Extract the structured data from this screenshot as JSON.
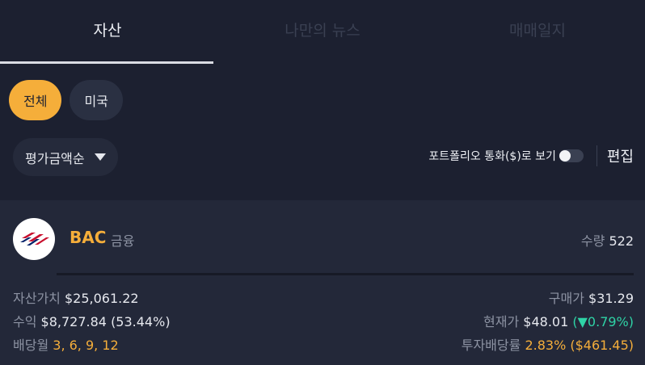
{
  "tabs": [
    {
      "label": "자산",
      "active": true
    },
    {
      "label": "나만의 뉴스",
      "active": false
    },
    {
      "label": "매매일지",
      "active": false
    }
  ],
  "filters": {
    "all": "전체",
    "us": "미국"
  },
  "sort": {
    "label": "평가금액순"
  },
  "portfolio_currency_toggle": {
    "label": "포트폴리오 통화($)로 보기",
    "on": false
  },
  "edit_label": "편집",
  "holding": {
    "ticker": "BAC",
    "sector": "금융",
    "quantity_label": "수량",
    "quantity": "522",
    "asset_value_label": "자산가치",
    "asset_value": "$25,061.22",
    "profit_label": "수익",
    "profit": "$8,727.84 (53.44%)",
    "dividend_month_label": "배당월",
    "dividend_months": "3, 6, 9, 12",
    "purchase_price_label": "구매가",
    "purchase_price": "$31.29",
    "current_price_label": "현재가",
    "current_price": "$48.01",
    "change_open": "(",
    "change_arrow": "▼",
    "change": "0.79%",
    "change_close": ")",
    "dividend_yield_label": "투자배당률",
    "dividend_yield": "2.83% ($461.45)"
  },
  "colors": {
    "accent": "#f5ae3a",
    "positive": "#2fd3a6",
    "background": "#1c2030",
    "card": "#232839"
  }
}
